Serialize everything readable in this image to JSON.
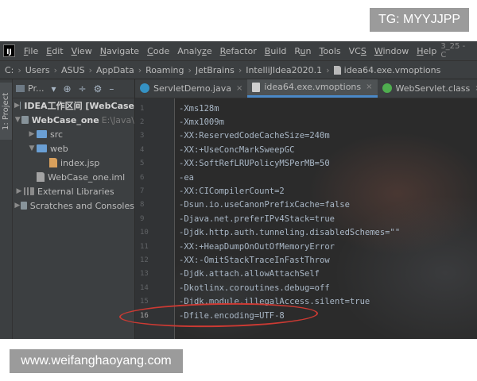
{
  "watermark": {
    "top_right": "TG: MYYJJPP",
    "bottom_left": "www.weifanghaoyang.com"
  },
  "window": {
    "logo_text": "IJ",
    "title_fragment": "3_25 - C",
    "menu": [
      {
        "mn": "F",
        "rest": "ile"
      },
      {
        "mn": "E",
        "rest": "dit"
      },
      {
        "mn": "V",
        "rest": "iew"
      },
      {
        "mn": "N",
        "rest": "avigate"
      },
      {
        "mn": "C",
        "rest": "ode"
      },
      {
        "mn": "",
        "pre": "Analy",
        "mn2": "z",
        "rest": "e"
      },
      {
        "mn": "R",
        "rest": "efactor"
      },
      {
        "mn": "B",
        "rest": "uild"
      },
      {
        "mn": "",
        "pre": "R",
        "mn2": "u",
        "rest": "n"
      },
      {
        "mn": "T",
        "rest": "ools"
      },
      {
        "mn": "",
        "pre": "VC",
        "mn2": "S",
        "rest": ""
      },
      {
        "mn": "W",
        "rest": "indow"
      },
      {
        "mn": "H",
        "rest": "elp"
      }
    ]
  },
  "breadcrumbs": [
    "C:",
    "Users",
    "ASUS",
    "AppData",
    "Roaming",
    "JetBrains",
    "IntelliJIdea2020.1",
    "idea64.exe.vmoptions"
  ],
  "sidebar": {
    "tool_tab": "1: Project"
  },
  "project": {
    "header_label": "Pr...",
    "tree": [
      {
        "label": "IDEA工作区间 [WebCase",
        "suffix": "",
        "indent": 0,
        "arrow": "▶",
        "icon": "folder",
        "bold": true
      },
      {
        "label": "WebCase_one",
        "suffix": "E:\\Java\\",
        "indent": 0,
        "arrow": "▼",
        "icon": "folder",
        "bold": true
      },
      {
        "label": "src",
        "suffix": "",
        "indent": 1,
        "arrow": "▶",
        "icon": "folder-blue",
        "bold": false
      },
      {
        "label": "web",
        "suffix": "",
        "indent": 1,
        "arrow": "▼",
        "icon": "folder-blue",
        "bold": false
      },
      {
        "label": "index.jsp",
        "suffix": "",
        "indent": 2,
        "arrow": "",
        "icon": "jsp",
        "bold": false
      },
      {
        "label": "WebCase_one.iml",
        "suffix": "",
        "indent": 1,
        "arrow": "",
        "icon": "iml",
        "bold": false
      },
      {
        "label": "External Libraries",
        "suffix": "",
        "indent": 0,
        "arrow": "▶",
        "icon": "folder-lib",
        "bold": false
      },
      {
        "label": "Scratches and Consoles",
        "suffix": "",
        "indent": 0,
        "arrow": "▶",
        "icon": "folder",
        "bold": false
      }
    ]
  },
  "tabs": [
    {
      "label": "ServletDemo.java",
      "icon": "c",
      "active": false
    },
    {
      "label": "idea64.exe.vmoptions",
      "icon": "file",
      "active": true
    },
    {
      "label": "WebServlet.class",
      "icon": "w",
      "active": false
    }
  ],
  "tab_close_glyph": "×",
  "editor": {
    "lines": [
      {
        "n": "1",
        "text": "-Xms128m"
      },
      {
        "n": "2",
        "text": "-Xmx1009m"
      },
      {
        "n": "3",
        "text": "-XX:ReservedCodeCacheSize=240m"
      },
      {
        "n": "4",
        "text": "-XX:+UseConcMarkSweepGC"
      },
      {
        "n": "5",
        "text": "-XX:SoftRefLRUPolicyMSPerMB=50"
      },
      {
        "n": "6",
        "text": "-ea"
      },
      {
        "n": "7",
        "text": "-XX:CICompilerCount=2"
      },
      {
        "n": "8",
        "text": "-Dsun.io.useCanonPrefixCache=false"
      },
      {
        "n": "9",
        "text": "-Djava.net.preferIPv4Stack=true"
      },
      {
        "n": "10",
        "text": "-Djdk.http.auth.tunneling.disabledSchemes=\"\""
      },
      {
        "n": "11",
        "text": "-XX:+HeapDumpOnOutOfMemoryError"
      },
      {
        "n": "12",
        "text": "-XX:-OmitStackTraceInFastThrow"
      },
      {
        "n": "13",
        "text": "-Djdk.attach.allowAttachSelf"
      },
      {
        "n": "14",
        "text": "-Dkotlinx.coroutines.debug=off"
      },
      {
        "n": "15",
        "text": "-Djdk.module.illegalAccess.silent=true"
      },
      {
        "n": "16",
        "text": "-Dfile.encoding=UTF-8"
      }
    ],
    "highlighted_line": "16"
  },
  "colors": {
    "highlight_mark": "#cc3a33",
    "tab_underline": "#4a88c7"
  }
}
